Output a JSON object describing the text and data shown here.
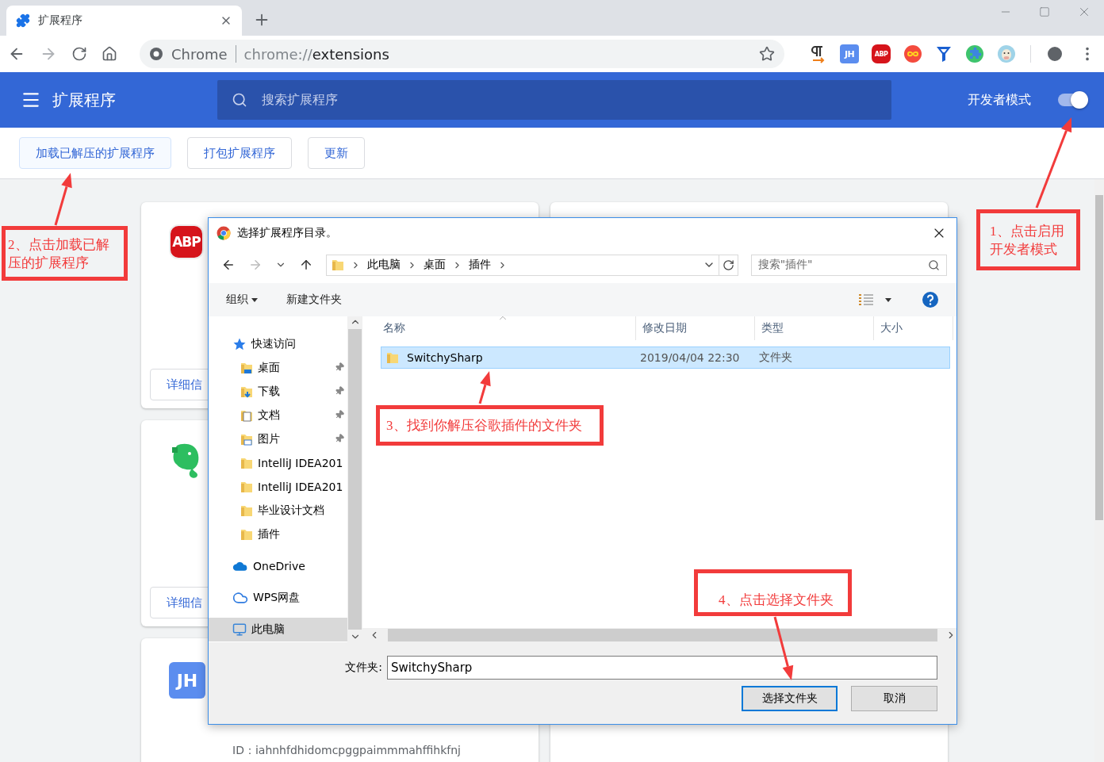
{
  "browser": {
    "tab": {
      "title": "扩展程序"
    },
    "address": {
      "origin": "Chrome",
      "url_scheme": "chrome://",
      "url_path": "extensions"
    },
    "extensions": [
      {
        "kind": "pilcrow"
      },
      {
        "kind": "letters",
        "label": "JH"
      },
      {
        "kind": "stop",
        "label": "ABP"
      },
      {
        "kind": "infinity"
      },
      {
        "kind": "funnel"
      },
      {
        "kind": "puzzle"
      },
      {
        "kind": "cow"
      }
    ]
  },
  "header": {
    "title": "扩展程序",
    "search": {
      "placeholder": "搜索扩展程序"
    },
    "developer_mode": {
      "label": "开发者模式",
      "on": true
    }
  },
  "actions": [
    "加载已解压的扩展程序",
    "打包扩展程序",
    "更新"
  ],
  "cards": [
    {
      "kind": "stop",
      "logo_label": "ABP",
      "button": "详细信"
    },
    {
      "kind": "elephant",
      "button": "详细信"
    },
    {
      "kind": "letters",
      "logo_label": "JH",
      "id_text": "ID：iahnhfdhidomcpggpaimmmahffihkfnj"
    }
  ],
  "dialog": {
    "title": "选择扩展程序目录。",
    "path": [
      "此电脑",
      "桌面",
      "插件"
    ],
    "search": {
      "placeholder": "搜索\"插件\""
    },
    "commands": [
      {
        "label": "组织",
        "dropdown": true
      },
      {
        "label": "新建文件夹",
        "dropdown": false
      }
    ],
    "nav": [
      {
        "label": "快速访问",
        "kind": "star",
        "selected": false,
        "children": [
          {
            "label": "桌面",
            "kind": "desktop",
            "pinned": true,
            "selected": false
          },
          {
            "label": "下载",
            "kind": "download",
            "pinned": true,
            "selected": false
          },
          {
            "label": "文档",
            "kind": "document",
            "pinned": true,
            "selected": false
          },
          {
            "label": "图片",
            "kind": "picture",
            "pinned": true,
            "selected": false
          },
          {
            "label": "IntelliJ IDEA201",
            "kind": "folder",
            "pinned": false,
            "selected": false
          },
          {
            "label": "IntelliJ IDEA201",
            "kind": "folder",
            "pinned": false,
            "selected": false
          },
          {
            "label": "毕业设计文档",
            "kind": "folder",
            "pinned": false,
            "selected": false
          },
          {
            "label": "插件",
            "kind": "folder",
            "pinned": false,
            "selected": false
          }
        ]
      },
      {
        "label": "OneDrive",
        "kind": "cloud",
        "selected": false
      },
      {
        "label": "WPS网盘",
        "kind": "outline",
        "selected": false
      },
      {
        "label": "此电脑",
        "kind": "computer",
        "selected": true
      }
    ],
    "columns": [
      "名称",
      "修改日期",
      "类型",
      "大小"
    ],
    "rows": [
      {
        "name": "SwitchySharp",
        "modified": "2019/04/04 22:30",
        "type": "文件夹",
        "selected": true
      }
    ],
    "folder_label": "文件夹:",
    "folder_value": "SwitchySharp",
    "buttons": [
      {
        "label": "选择文件夹",
        "default": true
      },
      {
        "label": "取消",
        "default": false
      }
    ]
  },
  "annotations": [
    {
      "lines": [
        "1、点击启用",
        "开发者模式"
      ]
    },
    {
      "lines": [
        "2、点击加载已解",
        "压的扩展程序"
      ]
    },
    {
      "lines": [
        "3、找到你解压谷歌插件的文件夹"
      ]
    },
    {
      "lines": [
        "4、点击选择文件夹"
      ]
    }
  ]
}
